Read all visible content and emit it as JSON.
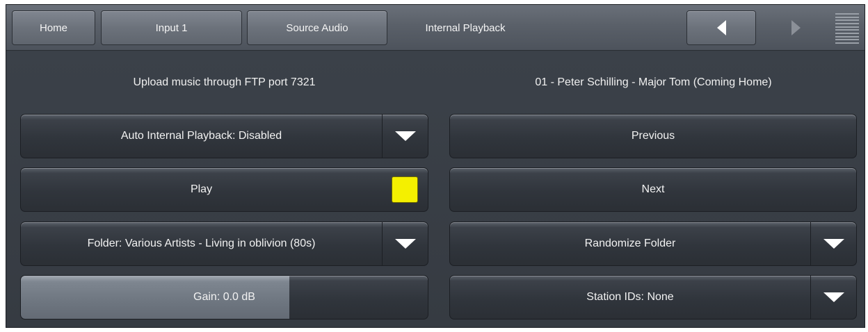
{
  "topbar": {
    "tabs": [
      {
        "label": "Home"
      },
      {
        "label": "Input 1"
      },
      {
        "label": "Source Audio"
      },
      {
        "label": "Internal Playback"
      }
    ]
  },
  "info": {
    "ftp_message": "Upload music through FTP port 7321",
    "now_playing": "01 - Peter Schilling - Major Tom (Coming Home)"
  },
  "controls": {
    "auto_playback_label": "Auto Internal Playback: Disabled",
    "play_label": "Play",
    "play_indicator_color": "#f4f000",
    "folder_label": "Folder: Various Artists - Living in oblivion (80s)",
    "gain_label": "Gain: 0.0 dB",
    "gain_fill_fraction": 0.66,
    "previous_label": "Previous",
    "next_label": "Next",
    "randomize_label": "Randomize Folder",
    "station_ids_label": "Station IDs: None"
  },
  "icons": {
    "nav_prev": "arrow-left-icon",
    "nav_next": "arrow-right-icon",
    "menu": "menu-icon",
    "dropdown": "chevron-down-icon"
  }
}
